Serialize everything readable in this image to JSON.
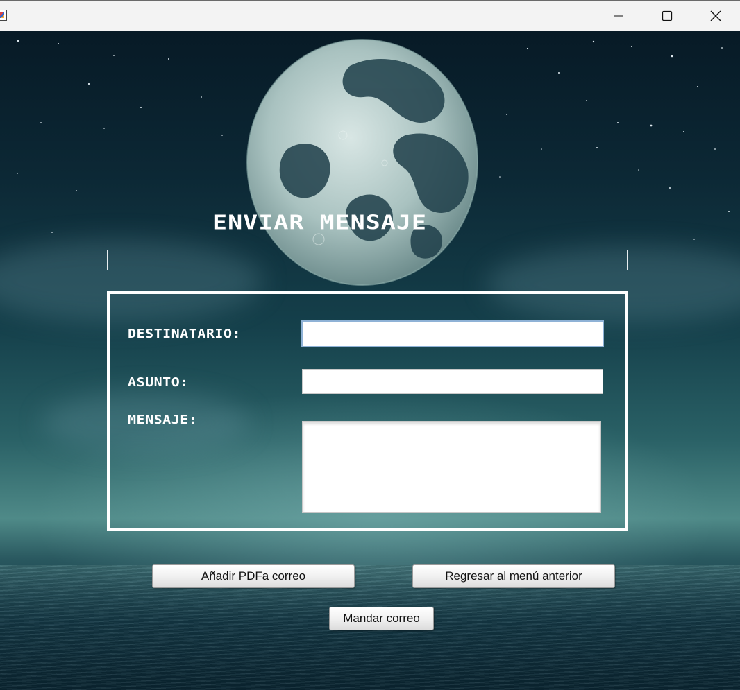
{
  "window": {
    "controls": {
      "minimize_icon": "minimize-icon",
      "maximize_icon": "maximize-icon",
      "close_icon": "close-icon"
    }
  },
  "form": {
    "title": "ENVIAR MENSAJE",
    "status_text": "",
    "labels": {
      "destinatario": "DESTINATARIO:",
      "asunto": "ASUNTO:",
      "mensaje": "MENSAJE:"
    },
    "fields": {
      "destinatario": "",
      "asunto": "",
      "mensaje": ""
    },
    "buttons": {
      "add_pdf": "Añadir PDFa correo",
      "back": "Regresar al menú anterior",
      "send": "Mandar correo"
    }
  },
  "colors": {
    "title_bar": "#f3f3f3",
    "form_text": "#ffffff",
    "focus_border": "#8fb2d6"
  }
}
